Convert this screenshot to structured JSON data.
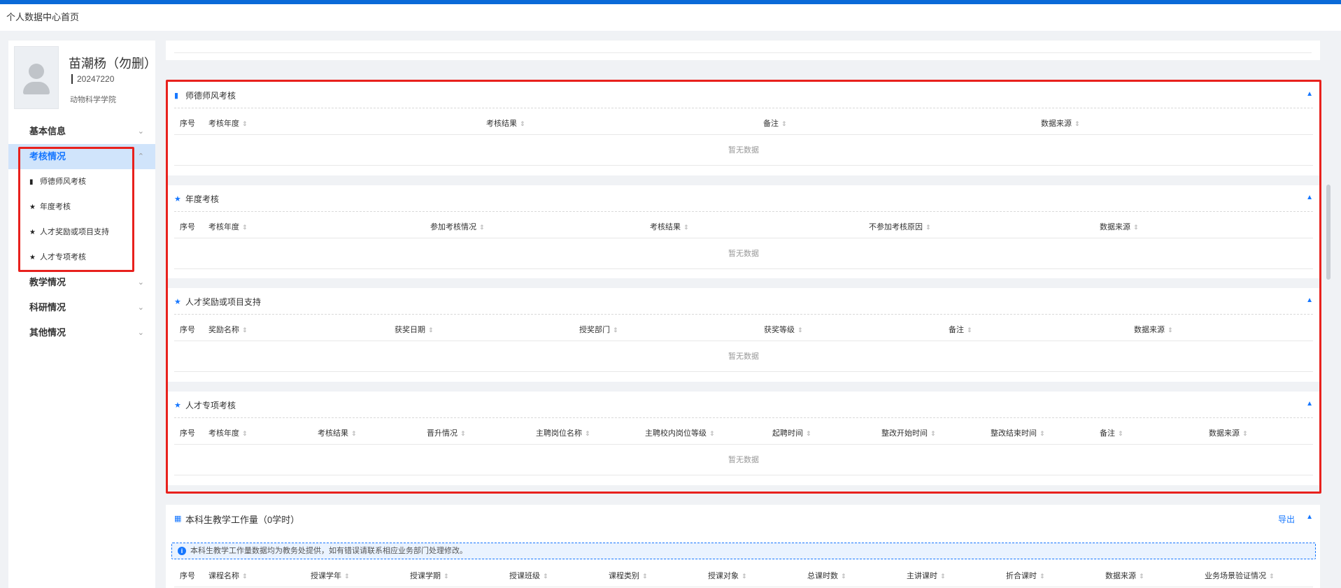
{
  "breadcrumb": {
    "title": "个人数据中心首页"
  },
  "colors": {
    "accent": "#1677ff",
    "topbar": "#0a6ad8",
    "highlight": "#e8211d",
    "active_bg": "#d0e4fb"
  },
  "profile": {
    "name": "苗潮杨（勿删）",
    "id": "20247220",
    "department": "动物科学学院"
  },
  "sidebar": {
    "items": [
      {
        "label": "基本信息",
        "icon": "chevron-down-icon"
      },
      {
        "label": "考核情况",
        "icon": "chevron-up-icon"
      },
      {
        "label": "教学情况",
        "icon": "chevron-down-icon"
      },
      {
        "label": "科研情况",
        "icon": "chevron-down-icon"
      },
      {
        "label": "其他情况",
        "icon": "chevron-down-icon"
      }
    ],
    "sub_items": [
      {
        "label": "师德师风考核",
        "icon": "book-icon"
      },
      {
        "label": "年度考核",
        "icon": "star-icon"
      },
      {
        "label": "人才奖励或项目支持",
        "icon": "star-icon"
      },
      {
        "label": "人才专项考核",
        "icon": "star-icon"
      }
    ]
  },
  "sections": {
    "ethics": {
      "title": "师德师风考核",
      "columns": [
        "序号",
        "考核年度",
        "考核结果",
        "备注",
        "数据来源"
      ],
      "empty": "暂无数据"
    },
    "annual": {
      "title": "年度考核",
      "columns": [
        "序号",
        "考核年度",
        "参加考核情况",
        "考核结果",
        "不参加考核原因",
        "数据来源"
      ],
      "empty": "暂无数据"
    },
    "talent_award": {
      "title": "人才奖励或项目支持",
      "columns": [
        "序号",
        "奖励名称",
        "获奖日期",
        "授奖部门",
        "获奖等级",
        "备注",
        "数据来源"
      ],
      "empty": "暂无数据"
    },
    "talent_special": {
      "title": "人才专项考核",
      "columns": [
        "序号",
        "考核年度",
        "考核结果",
        "晋升情况",
        "主聘岗位名称",
        "主聘校内岗位等级",
        "起聘时间",
        "整改开始时间",
        "整改结束时间",
        "备注",
        "数据来源"
      ],
      "empty": "暂无数据"
    },
    "teaching": {
      "title": "本科生教学工作量（0学时）",
      "export_label": "导出",
      "notice": "本科生教学工作量数据均为教务处提供，如有错误请联系相应业务部门处理修改。",
      "columns": [
        "序号",
        "课程名称",
        "授课学年",
        "授课学期",
        "授课班级",
        "课程类别",
        "授课对象",
        "总课时数",
        "主讲课时",
        "折合课时",
        "数据来源",
        "业务场景验证情况"
      ]
    }
  },
  "icons": {
    "collapse": "caret-up-icon",
    "sort": "sort-icon",
    "info": "info-icon"
  }
}
